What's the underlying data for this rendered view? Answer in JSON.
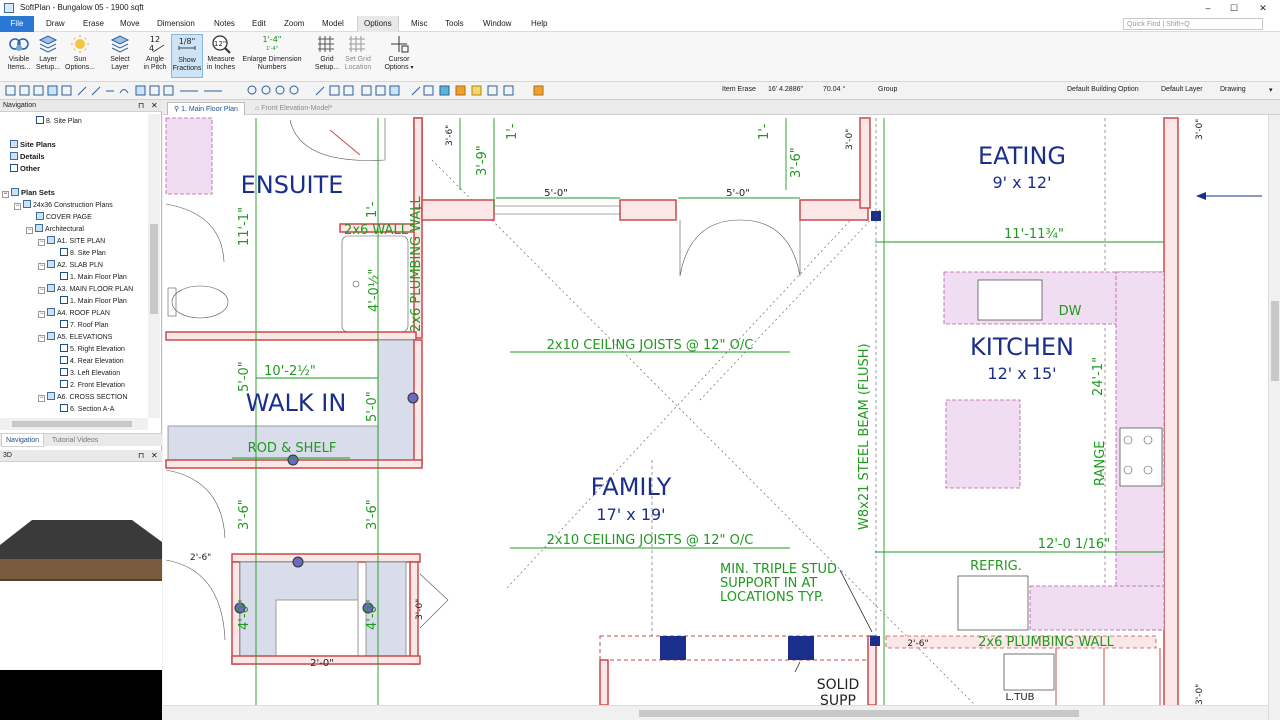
{
  "window": {
    "title": "SoftPlan - Bungalow 05 - 1900 sqft",
    "controls": [
      "–",
      "☐",
      "✕"
    ]
  },
  "menu": {
    "items": [
      "File",
      "Draw",
      "Erase",
      "Move",
      "Dimension",
      "Notes",
      "Edit",
      "Zoom",
      "Model",
      "Options",
      "Misc",
      "Tools",
      "Window",
      "Help"
    ],
    "quick_find_placeholder": "Quick Find | Shift+Q"
  },
  "ribbon": {
    "buttons": [
      {
        "line1": "Visible",
        "line2": "Items...",
        "icon": "visible-items-icon"
      },
      {
        "line1": "Layer",
        "line2": "Setup...",
        "icon": "layer-setup-icon"
      },
      {
        "line1": "Sun",
        "line2": "Options...",
        "icon": "sun-icon"
      },
      {
        "line1": "Select",
        "line2": "Layer",
        "icon": "select-layer-icon"
      },
      {
        "line1": "Angle",
        "line2": "in Pitch",
        "icon": "angle-pitch-icon",
        "glyph_top": "12",
        "glyph_mid": "4"
      },
      {
        "line1": "Show",
        "line2": "Fractions",
        "icon": "fraction-icon",
        "glyph_top": "1/8\""
      },
      {
        "line1": "Measure",
        "line2": "in Inches",
        "icon": "measure-inches-icon",
        "glyph_top": "12\""
      },
      {
        "line1": "Enlarge Dimension",
        "line2": "Numbers",
        "icon": "enlarge-dimension-icon",
        "glyph_top": "1'-4\"",
        "glyph_mid": "1'-4\""
      },
      {
        "line1": "Grid",
        "line2": "Setup...",
        "icon": "grid-setup-icon"
      },
      {
        "line1": "Set Grid",
        "line2": "Location",
        "icon": "set-grid-location-icon"
      },
      {
        "line1": "Cursor",
        "line2": "Options",
        "icon": "cursor-options-icon"
      }
    ]
  },
  "toolbar": {
    "mode": "Item Erase",
    "length": "16' 4.2886\"",
    "angle": "70.04 °",
    "group": "Group",
    "building_option": "Default Building Option",
    "layer": "Default Layer",
    "view": "Drawing"
  },
  "navigation": {
    "header": "Navigation",
    "tree": [
      {
        "label": "8. Site Plan",
        "level": 3,
        "icon": "plan",
        "bold": false
      },
      {
        "label": "Site Plans",
        "level": 1,
        "icon": "folder",
        "bold": true
      },
      {
        "label": "Details",
        "level": 1,
        "icon": "folder",
        "bold": true
      },
      {
        "label": "Other",
        "level": 1,
        "icon": "plan",
        "bold": true
      },
      {
        "label": "Plan Sets",
        "level": 0,
        "icon": "folder",
        "bold": true
      },
      {
        "label": "24x36 Construction Plans",
        "level": 1,
        "icon": "folder",
        "bold": false
      },
      {
        "label": "COVER PAGE",
        "level": 2,
        "icon": "folder",
        "bold": false
      },
      {
        "label": "Architectural",
        "level": 2,
        "icon": "folder",
        "bold": false
      },
      {
        "label": "A1. SITE PLAN",
        "level": 3,
        "icon": "folder",
        "bold": false
      },
      {
        "label": "8. Site Plan",
        "level": 4,
        "icon": "plan",
        "bold": false
      },
      {
        "label": "A2. SLAB PLN",
        "level": 3,
        "icon": "folder",
        "bold": false
      },
      {
        "label": "1. Main Floor Plan",
        "level": 4,
        "icon": "plan",
        "bold": false
      },
      {
        "label": "A3. MAIN FLOOR PLAN",
        "level": 3,
        "icon": "folder",
        "bold": false
      },
      {
        "label": "1. Main Floor Plan",
        "level": 4,
        "icon": "plan",
        "bold": false
      },
      {
        "label": "A4. ROOF PLAN",
        "level": 3,
        "icon": "folder",
        "bold": false
      },
      {
        "label": "7. Roof Plan",
        "level": 4,
        "icon": "plan",
        "bold": false
      },
      {
        "label": "A5. ELEVATIONS",
        "level": 3,
        "icon": "folder",
        "bold": false
      },
      {
        "label": "5. Right Elevation",
        "level": 4,
        "icon": "plan",
        "bold": false
      },
      {
        "label": "4. Rear Elevation",
        "level": 4,
        "icon": "plan",
        "bold": false
      },
      {
        "label": "3. Left Elevation",
        "level": 4,
        "icon": "plan",
        "bold": false
      },
      {
        "label": "2. Front Elevation",
        "level": 4,
        "icon": "plan",
        "bold": false
      },
      {
        "label": "A6. CROSS SECTION",
        "level": 3,
        "icon": "folder",
        "bold": false
      },
      {
        "label": "6. Section A-A",
        "level": 4,
        "icon": "plan",
        "bold": false
      }
    ],
    "tabs": [
      "Navigation",
      "Tutorial Videos"
    ]
  },
  "panel_3d": {
    "header": "3D"
  },
  "doc_tabs": [
    "1. Main Floor Plan",
    "Front Elevation-Model*"
  ],
  "plan": {
    "rooms": [
      {
        "name": "ENSUITE",
        "size": ""
      },
      {
        "name": "WALK IN",
        "size": ""
      },
      {
        "name": "EATING",
        "size": "9' x 12'"
      },
      {
        "name": "KITCHEN",
        "size": "12' x 15'"
      },
      {
        "name": "FAMILY",
        "size": "17' x 19'"
      }
    ],
    "notes": {
      "ceiling_joists": "2x10 CEILING JOISTS @ 12\" O/C",
      "rod_shelf": "ROD & SHELF",
      "steel_beam": "W8x21 STEEL BEAM (FLUSH)",
      "plumbing_wall": "2x6 PLUMBING WALL",
      "wall_2x6": "2x6 WALL",
      "refrig": "REFRIG.",
      "range": "RANGE",
      "dw": "DW",
      "ltub": "L.TUB",
      "stud_line1": "MIN. TRIPLE STUD",
      "stud_line2": "SUPPORT IN AT",
      "stud_line3": "LOCATIONS TYP.",
      "solid": "SOLID",
      "supp": "SUPP"
    },
    "dimensions": {
      "d_5_0": "5'-0\"",
      "d_11_11": "11'-11¾\"",
      "d_10_2": "10'-2½\"",
      "d_4_0_half": "4'-0½\"",
      "d_11_1": "11'-1\"",
      "d_24_1": "24'-1\"",
      "d_12_0": "12'-0 1/16\"",
      "d_3_6": "3'-6\"",
      "d_3_9": "3'-9\"",
      "d_2_6": "2'-6\"",
      "d_4_0": "4'-0\"",
      "d_2_0": "2'-0\"",
      "d_1": "1'-",
      "d_3_0": "3'-0\""
    }
  }
}
